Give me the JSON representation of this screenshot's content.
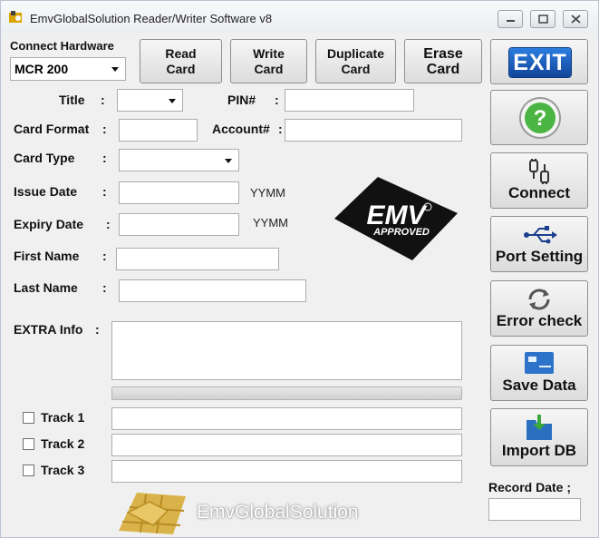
{
  "window": {
    "title": "EmvGlobalSolution Reader/Writer Software v8"
  },
  "connect": {
    "label": "Connect Hardware",
    "device": "MCR 200"
  },
  "top_buttons": {
    "read": "Read\nCard",
    "write": "Write\nCard",
    "duplicate": "Duplicate\nCard",
    "erase": "Erase\nCard",
    "exit": "EXIT"
  },
  "form": {
    "title_label": "Title",
    "pin_label": "PIN#",
    "card_format_label": "Card Format",
    "account_label": "Account#",
    "card_type_label": "Card Type",
    "issue_date_label": "Issue Date",
    "expiry_date_label": "Expiry Date",
    "date_format": "YYMM",
    "first_name_label": "First Name",
    "last_name_label": "Last Name",
    "extra_info_label": "EXTRA Info",
    "colon": ":"
  },
  "tracks": [
    {
      "label": "Track 1",
      "checked": false
    },
    {
      "label": "Track 2",
      "checked": false
    },
    {
      "label": "Track 3",
      "checked": false
    }
  ],
  "emv_logo": {
    "text": "EMV",
    "sub": "APPROVED"
  },
  "brand": {
    "text": "EmvGlobalSolution"
  },
  "side_buttons": {
    "help_icon": "question-icon",
    "connect": "Connect",
    "port": "Port Setting",
    "error": "Error check",
    "save": "Save Data",
    "import": "Import DB"
  },
  "record_date": {
    "label": "Record Date ;"
  },
  "colors": {
    "exit_blue": "#1a5fb4",
    "help_green": "#3fae3a",
    "emv_black": "#111111"
  }
}
